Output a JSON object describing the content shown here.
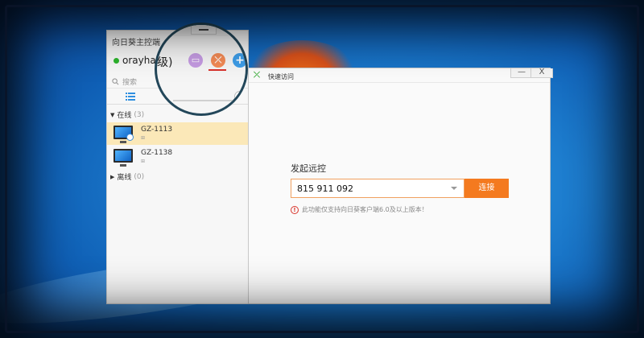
{
  "colors": {
    "accent": "#f47a1f",
    "online": "#2db52d",
    "selected_row": "#fbe8b8",
    "warning": "#d9342b",
    "magnifier_ring": "#23475a",
    "underline": "#d9302a"
  },
  "client": {
    "title": "向日葵主控端",
    "username": "orayhais",
    "search_placeholder": "搜索",
    "list_view_icon": "list-icon",
    "groups": [
      {
        "label": "在线",
        "count": "(3)",
        "expanded": true
      },
      {
        "label": "离线",
        "count": "(0)",
        "expanded": false
      }
    ],
    "devices": [
      {
        "name": "GZ-1113",
        "os_icon": "windows-icon",
        "selected": true
      },
      {
        "name": "GZ-1138",
        "os_icon": "windows-icon",
        "selected": false
      }
    ]
  },
  "magnifier": {
    "text": "级)",
    "icons": [
      "remote-desktop-icon",
      "quick-access-icon",
      "add-icon"
    ]
  },
  "quick": {
    "title": "快速访问",
    "heading": "发起远控",
    "id_value": "815 911 092",
    "connect_label": "连接",
    "note": "此功能仅支持向日葵客户端6.0及以上版本！",
    "minimize_glyph": "—",
    "close_glyph": "X"
  }
}
